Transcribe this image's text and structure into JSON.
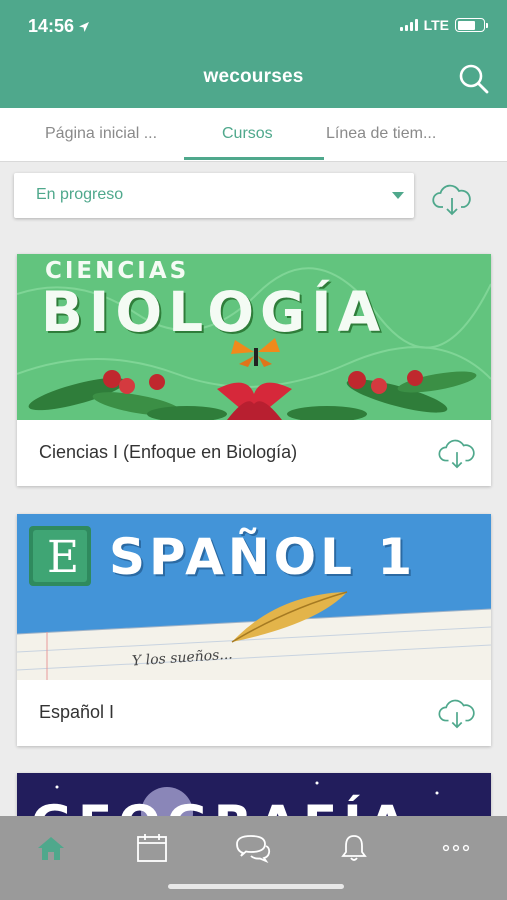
{
  "status_bar": {
    "time": "14:56",
    "network": "LTE"
  },
  "header": {
    "title": "wecourses",
    "search_icon": "search-icon"
  },
  "tabs": [
    {
      "label": "Página inicial ...",
      "active": false
    },
    {
      "label": "Cursos",
      "active": true
    },
    {
      "label": "Línea de tiem...",
      "active": false
    }
  ],
  "filter": {
    "selected": "En progreso",
    "download_icon": "cloud-download-icon"
  },
  "courses": [
    {
      "title": "Ciencias I (Enfoque en Biología)",
      "banner_top": "CIENCIAS",
      "banner_main": "BIOLOGÍA"
    },
    {
      "title": "Español I",
      "banner_badge": "E",
      "banner_main": "SPAÑOL 1",
      "banner_script": "Y los sueños..."
    },
    {
      "banner_main": "GEOGRAFÍA"
    }
  ],
  "bottom_nav": [
    {
      "icon": "home-icon",
      "active": true
    },
    {
      "icon": "calendar-icon",
      "active": false
    },
    {
      "icon": "chat-icon",
      "active": false
    },
    {
      "icon": "bell-icon",
      "active": false
    },
    {
      "icon": "more-icon",
      "active": false
    }
  ],
  "colors": {
    "accent": "#4fa88c",
    "nav_bg": "#9a9a9a"
  }
}
